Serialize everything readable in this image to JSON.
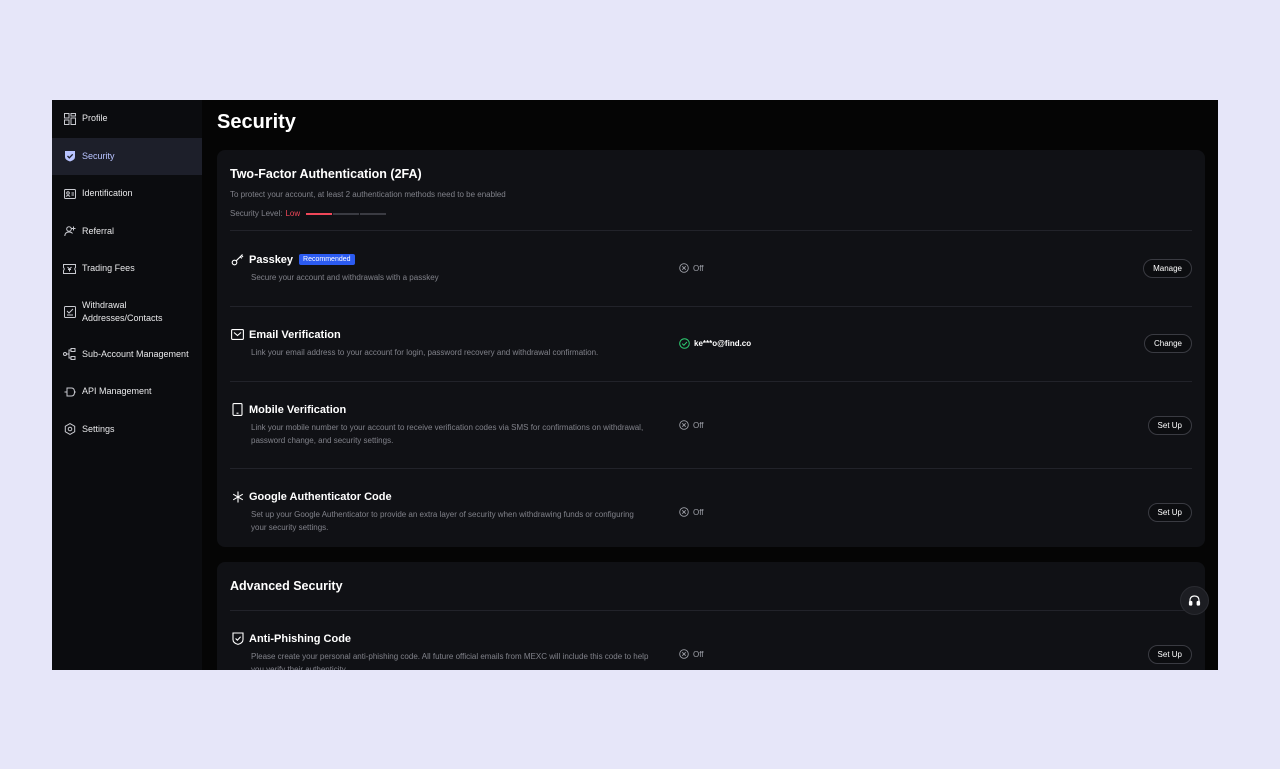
{
  "sidebar": {
    "items": [
      {
        "label": "Profile",
        "icon": "profile-icon"
      },
      {
        "label": "Security",
        "icon": "shield-icon"
      },
      {
        "label": "Identification",
        "icon": "id-card-icon"
      },
      {
        "label": "Referral",
        "icon": "referral-icon"
      },
      {
        "label": "Trading Fees",
        "icon": "ticket-icon"
      },
      {
        "label": "Withdrawal Addresses/Contacts",
        "icon": "address-book-icon"
      },
      {
        "label": "Sub-Account Management",
        "icon": "sub-account-icon"
      },
      {
        "label": "API Management",
        "icon": "api-icon"
      },
      {
        "label": "Settings",
        "icon": "gear-icon"
      }
    ],
    "active_label": "Security"
  },
  "page": {
    "title": "Security"
  },
  "twofa": {
    "title": "Two-Factor Authentication (2FA)",
    "subtitle": "To protect your account, at least 2 authentication methods need to be enabled",
    "level_label": "Security Level:",
    "level_value": "Low",
    "level_segments_total": 3,
    "level_segments_on": 1,
    "rows": [
      {
        "title": "Passkey",
        "badge": "Recommended",
        "desc": "Secure your account and withdrawals with a passkey",
        "status": "Off",
        "button": "Manage",
        "icon": "key-icon"
      },
      {
        "title": "Email Verification",
        "desc": "Link your email address to your account for login, password recovery and withdrawal confirmation.",
        "status": "ke***o@find.co",
        "button": "Change",
        "icon": "mail-icon"
      },
      {
        "title": "Mobile Verification",
        "desc": "Link your mobile number to your account to receive verification codes via SMS for confirmations on withdrawal, password change, and security settings.",
        "status": "Off",
        "button": "Set Up",
        "icon": "phone-icon"
      },
      {
        "title": "Google Authenticator Code",
        "desc": "Set up your Google Authenticator to provide an extra layer of security when withdrawing funds or configuring your security settings.",
        "status": "Off",
        "button": "Set Up",
        "icon": "authenticator-icon"
      }
    ]
  },
  "advanced": {
    "title": "Advanced Security",
    "rows": [
      {
        "title": "Anti-Phishing Code",
        "desc": "Please create your personal anti-phishing code. All future official emails from MEXC will include this code to help you verify their authenticity.",
        "status": "Off",
        "button": "Set Up",
        "icon": "shield-check-icon"
      }
    ]
  },
  "colors": {
    "accent": "#b8c3ff",
    "danger": "#f04759",
    "badge": "#2b5bf1",
    "success": "#2ecc71"
  }
}
